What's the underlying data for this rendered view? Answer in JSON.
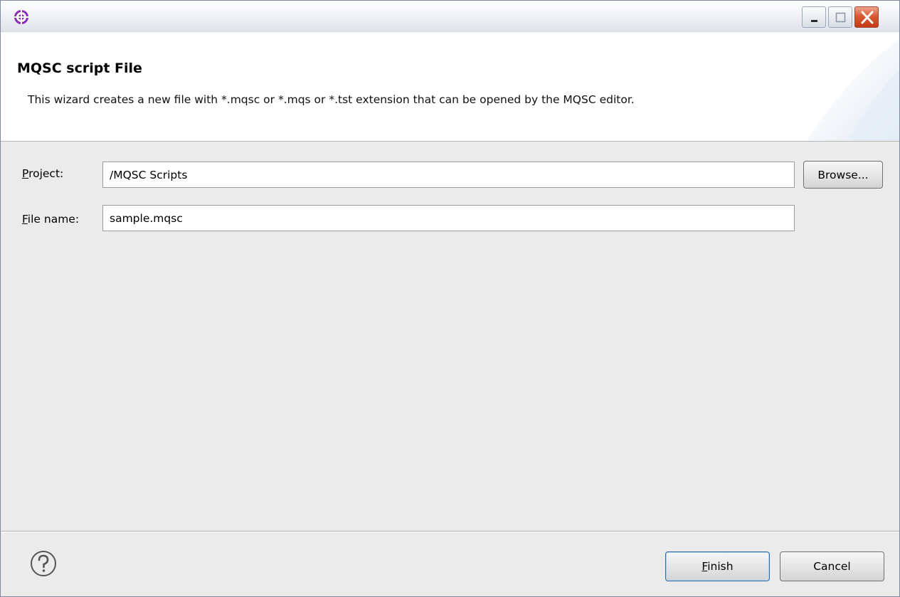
{
  "titlebar": {
    "title": "",
    "icons": {
      "app": "eclipse-crosshair-icon",
      "minimize": "minimize-icon",
      "maximize": "maximize-icon",
      "close": "close-icon"
    }
  },
  "header": {
    "title": "MQSC script File",
    "description": "This wizard creates a new file with *.mqsc or *.mqs or *.tst extension that can be opened by the MQSC editor."
  },
  "form": {
    "project": {
      "label_mnemonic": "P",
      "label_rest": "roject:",
      "value": "/MQSC Scripts"
    },
    "file_name": {
      "label_mnemonic": "F",
      "label_rest": "ile name:",
      "value": "sample.mqsc"
    },
    "browse_label": "Browse..."
  },
  "footer": {
    "help_icon": "help-question-icon",
    "finish_mnemonic": "F",
    "finish_rest": "inish",
    "cancel_label": "Cancel"
  },
  "colors": {
    "accent_purple": "#8a2ab8",
    "close_red": "#d65a34",
    "dialog_bg": "#ebebeb"
  }
}
